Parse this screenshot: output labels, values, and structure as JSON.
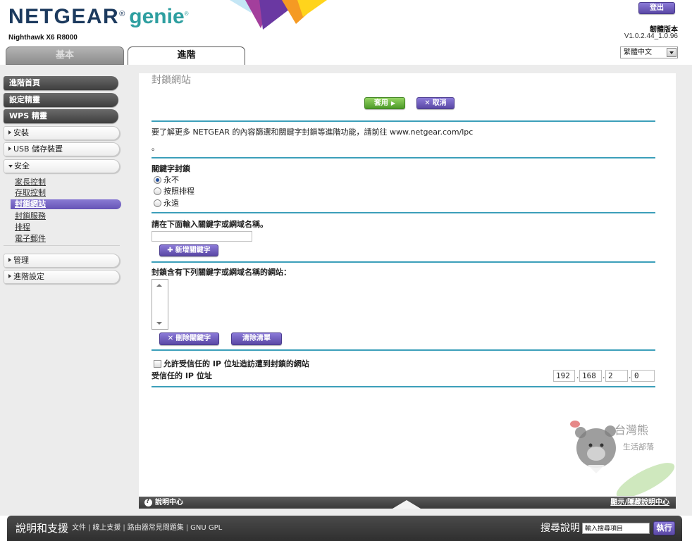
{
  "header": {
    "brand": "NETGEAR",
    "brand_mark": "®",
    "product": "genie",
    "product_mark": "®",
    "model": "Nighthawk X6 R8000",
    "logout": "登出",
    "firmware_label": "韌體版本",
    "firmware_version": "V1.0.2.44_1.0.96",
    "language": "繁體中文"
  },
  "tabs": {
    "basic": "基本",
    "advanced": "進階",
    "active": "進階"
  },
  "sidebar": {
    "advanced_home": "進階首頁",
    "setup_wizard": "設定精靈",
    "wps_wizard": "WPS 精靈",
    "setup": "安裝",
    "usb_storage": "USB 儲存裝置",
    "security": "安全",
    "security_items": [
      "家長控制",
      "存取控制",
      "封鎖網站",
      "封鎖服務",
      "排程",
      "電子郵件"
    ],
    "selected": "封鎖網站",
    "administration": "管理",
    "advanced_setup": "進階設定"
  },
  "main": {
    "title": "封鎖網站",
    "apply": "套用",
    "cancel": "取消",
    "info_text": "要了解更多 NETGEAR 的內容篩選和關鍵字封鎖等進階功能，請前往 www.netgear.com/lpc",
    "info_period": "。",
    "keyword_blocking_label": "關鍵字封鎖",
    "blocking_options": [
      {
        "label": "永不",
        "checked": true
      },
      {
        "label": "按照排程",
        "checked": false
      },
      {
        "label": "永遠",
        "checked": false
      }
    ],
    "keyword_prompt": "請在下面輸入關鍵字或網域名稱。",
    "keyword_input_value": "",
    "add_keyword": "新增關鍵字",
    "blocked_list_label": "封鎖含有下列關鍵字或網域名稱的網站：",
    "blocked_list": [],
    "delete_keyword": "刪除關鍵字",
    "clear_list": "清除清單",
    "allow_trusted_label": "允許受信任的 IP 位址造訪遭到封鎖的網站",
    "allow_trusted_checked": false,
    "trusted_ip_label": "受信任的 IP 位址",
    "trusted_ip": [
      "192",
      "168",
      "2",
      "0"
    ],
    "ip_separator": "."
  },
  "help_bar": {
    "help_center": "說明中心",
    "toggle": "顯示/隱藏說明中心"
  },
  "footer": {
    "title": "說明和支援",
    "links": [
      "文件",
      "線上支援",
      "路由器常見問題集",
      "GNU GPL"
    ],
    "link_separator": "|",
    "search_label": "搜尋說明",
    "search_placeholder": "輸入搜尋項目",
    "search_button": "執行"
  },
  "watermark": {
    "text": [
      "台灣熊",
      "生活部落"
    ]
  },
  "icons": {
    "apply": "play-icon",
    "cancel": "close-icon",
    "add": "plus-icon",
    "delete": "close-icon",
    "help": "help-icon",
    "language": "chevron-down-icon",
    "collapsed": "caret-right-icon",
    "expanded": "caret-down-icon"
  },
  "colors": {
    "accent_purple": "#6b59b9",
    "apply_green": "#5aa832",
    "separator_teal": "#3c9fba",
    "brand_navy": "#1c3a5e",
    "brand_teal": "#2e9fa0"
  }
}
